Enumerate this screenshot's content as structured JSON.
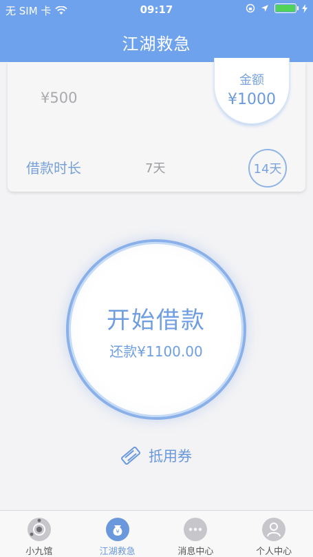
{
  "status": {
    "carrier": "无 SIM 卡",
    "time": "09:17"
  },
  "nav": {
    "title": "江湖救急"
  },
  "card": {
    "amount_low": "¥500",
    "amount_label": "金额",
    "amount_selected": "¥1000",
    "duration_label": "借款时长",
    "duration_short": "7天",
    "duration_selected": "14天"
  },
  "main": {
    "action": "开始借款",
    "repay": "还款¥1100.00"
  },
  "coupon": {
    "label": "抵用券"
  },
  "tabs": [
    {
      "label": "小九馆",
      "icon": "orbit-icon"
    },
    {
      "label": "江湖救急",
      "icon": "money-bag-icon"
    },
    {
      "label": "消息中心",
      "icon": "chat-bubble-icon"
    },
    {
      "label": "个人中心",
      "icon": "user-icon"
    }
  ],
  "colors": {
    "accent": "#6fa2ec",
    "active_tab": "#6a98dc",
    "battery": "#51d35a"
  }
}
